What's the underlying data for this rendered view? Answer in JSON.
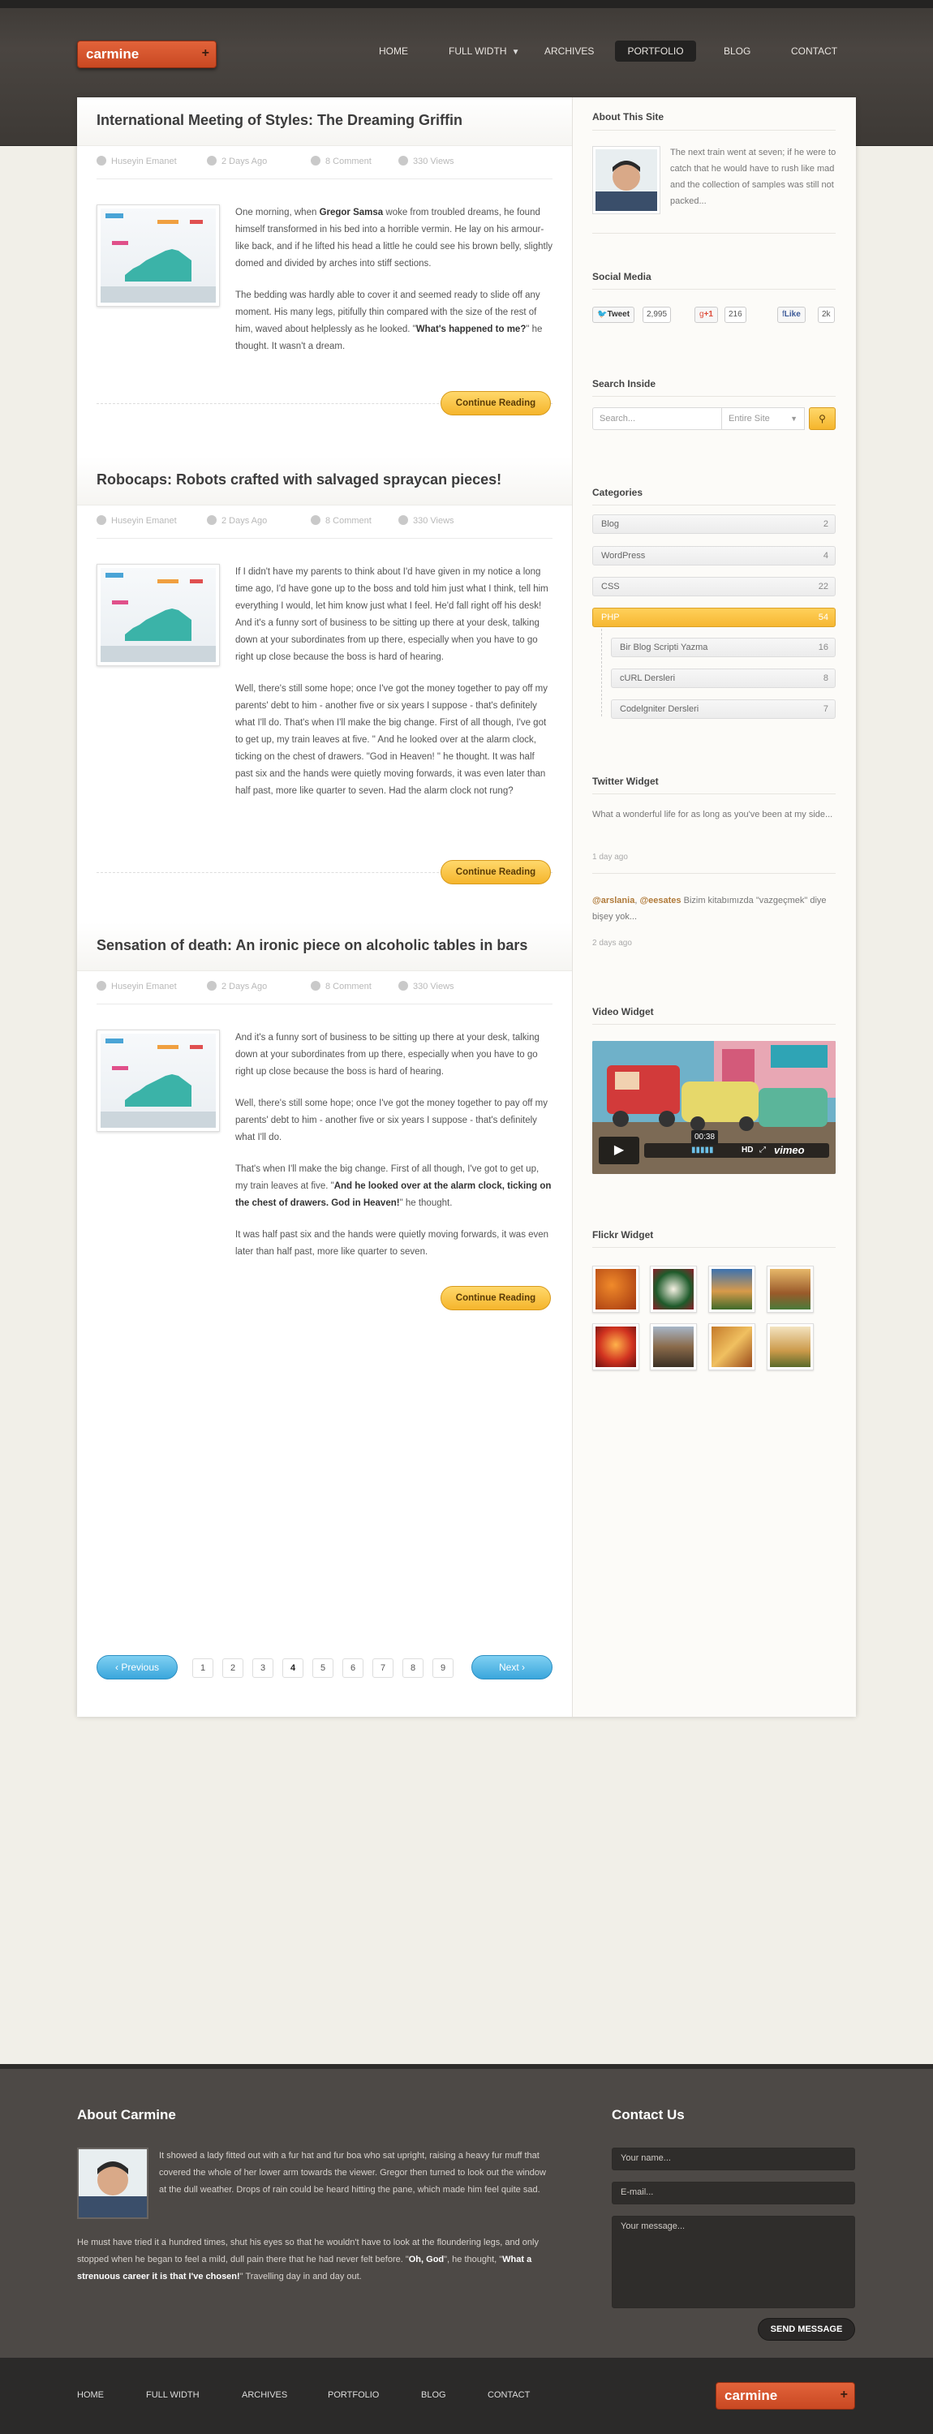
{
  "header": {
    "logo": "carmine",
    "logo_plus": "+",
    "nav": [
      "HOME",
      "FULL WIDTH",
      "ARCHIVES",
      "PORTFOLIO",
      "BLOG",
      "CONTACT"
    ],
    "active": "PORTFOLIO"
  },
  "posts": [
    {
      "title": "International Meeting of Styles: The Dreaming Griffin",
      "author": "Huseyin Emanet",
      "date": "2 Days Ago",
      "comments": "8 Comment",
      "views": "330 Views",
      "paragraphs": [
        [
          "One morning, when ",
          "Gregor Samsa",
          " woke from troubled dreams, he found himself transformed in his bed into a horrible vermin. He lay on his armour-like back, and if he lifted his head a little he could see his brown belly, slightly domed and divided by arches into stiff sections."
        ],
        [
          "The bedding was hardly able to cover it and seemed ready to slide off any moment. His many legs, pitifully thin compared with the size of the rest of him, waved about helplessly as he looked. \"",
          "What's happened to me?",
          "\" he thought. It wasn't a dream."
        ]
      ],
      "button": "Continue Reading"
    },
    {
      "title": "Robocaps: Robots crafted with salvaged spraycan pieces!",
      "author": "Huseyin Emanet",
      "date": "2 Days Ago",
      "comments": "8 Comment",
      "views": "330 Views",
      "paragraphs": [
        [
          "If I didn't have my parents to think about I'd have given in my notice a long time ago, I'd have gone up to the boss and told him just what I think, tell him everything I would, let him know just what I feel. He'd fall right off his desk! And it's a funny sort of business to be sitting up there at your desk, talking down at your subordinates from up there, especially when you have to go right up close because the boss is hard of hearing.",
          "",
          ""
        ],
        [
          "Well, there's still some hope; once I've got the money together to pay off my parents' debt to him - another five or six years I suppose - that's definitely what I'll do. That's when I'll make the big change. First of all though, I've got to get up, my train leaves at five. \" And he looked over at the alarm clock, ticking on the chest of drawers. \"God in Heaven! \" he thought. It was half past six and the hands were quietly moving forwards, it was even later than half past, more like quarter to seven. Had the alarm clock not rung?",
          "",
          ""
        ]
      ],
      "button": "Continue Reading"
    },
    {
      "title": "Sensation of death: An ironic piece on alcoholic tables in bars",
      "author": "Huseyin Emanet",
      "date": "2 Days Ago",
      "comments": "8 Comment",
      "views": "330 Views",
      "paragraphs": [
        [
          "And it's a funny sort of business to be sitting up there at your desk, talking down at your subordinates from up there, especially when you have to go right up close because the boss is hard of hearing.",
          "",
          ""
        ],
        [
          "Well, there's still some hope; once I've got the money together to pay off my parents' debt to him - another five or six years I suppose - that's definitely what I'll do.",
          "",
          ""
        ],
        [
          "That's when I'll make the big change. First of all though, I've got to get up, my train leaves at five. \"",
          "And he looked over at the alarm clock, ticking on the chest of drawers. God in Heaven!",
          "\" he thought."
        ],
        [
          "It was half past six and the hands were quietly moving forwards, it was even later than half past, more like quarter to seven.",
          "",
          ""
        ]
      ],
      "button": "Continue Reading"
    }
  ],
  "pagination": {
    "prev": "Previous",
    "next": "Next",
    "pages": [
      "1",
      "2",
      "3",
      "4",
      "5",
      "6",
      "7",
      "8",
      "9"
    ],
    "current": "4"
  },
  "sidebar": {
    "about_title": "About This Site",
    "about_text": "The next train went at seven; if he were to catch that he would have to rush like mad and the collection of samples was still not packed...",
    "social_title": "Social Media",
    "tweet_label": "Tweet",
    "tweet_count": "2,995",
    "gplus_label": "+1",
    "gplus_count": "216",
    "like_label": "Like",
    "like_count": "2k",
    "search_title": "Search Inside",
    "search_placeholder": "Search...",
    "search_scope": "Entire Site",
    "categories_title": "Categories",
    "categories": [
      {
        "name": "Blog",
        "count": "2"
      },
      {
        "name": "WordPress",
        "count": "4"
      },
      {
        "name": "CSS",
        "count": "22"
      },
      {
        "name": "PHP",
        "count": "54"
      }
    ],
    "subcategories": [
      {
        "name": "Bir Blog Scripti Yazma",
        "count": "16"
      },
      {
        "name": "cURL Dersleri",
        "count": "8"
      },
      {
        "name": "Codelgniter Dersleri",
        "count": "7"
      }
    ],
    "twitter_title": "Twitter Widget",
    "tweet1": "What a wonderful life for as long as you've been at my side...",
    "tweet1_time": "1 day ago",
    "tweet2_user1": "@arslania",
    "tweet2_sep": ", ",
    "tweet2_user2": "@eesates",
    "tweet2_text": " Bizim kitabımızda \"vazgeçmek\" diye bişey yok...",
    "tweet2_time": "2 days ago",
    "video_title": "Video Widget",
    "video_time": "00:38",
    "video_hd": "HD",
    "video_brand": "vimeo",
    "flickr_title": "Flickr Widget"
  },
  "footer": {
    "about_title": "About Carmine",
    "about_p1": "It showed a lady fitted out with a fur hat and fur boa who sat upright, raising a heavy fur muff that covered the whole of her lower arm towards the viewer. Gregor then turned to look out the window at the dull weather. Drops of rain could be heard hitting the pane, which made him feel quite sad.",
    "about_p2_a": "He must have tried it a hundred times, shut his eyes so that he wouldn't have to look at the floundering legs, and only stopped when he began to feel a mild, dull pain there that he had never felt before. \"",
    "about_p2_b": "Oh, God",
    "about_p2_c": "\", he thought, \"",
    "about_p2_d": "What a strenuous career it is that I've chosen!",
    "about_p2_e": "\" Travelling day in and day out.",
    "contact_title": "Contact Us",
    "name_ph": "Your name...",
    "email_ph": "E-mail...",
    "msg_ph": "Your message...",
    "send": "SEND MESSAGE",
    "nav": [
      "HOME",
      "FULL WIDTH",
      "ARCHIVES",
      "PORTFOLIO",
      "BLOG",
      "CONTACT"
    ],
    "logo": "carmine",
    "logo_plus": "+"
  }
}
